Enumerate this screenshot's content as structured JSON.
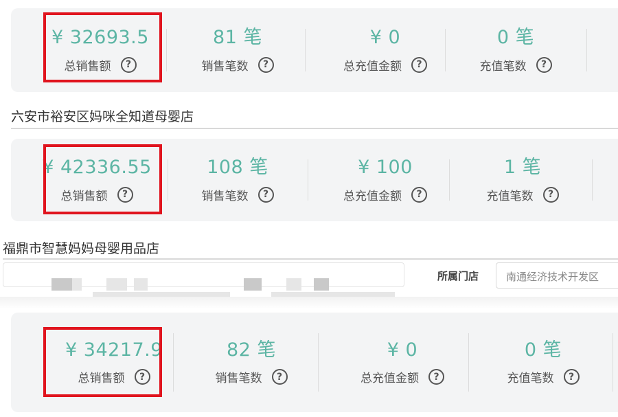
{
  "stores": [
    {
      "name": "",
      "stats": [
        {
          "value": "¥ 32693.5",
          "label": "总销售额"
        },
        {
          "value": "81 笔",
          "label": "销售笔数"
        },
        {
          "value": "¥ 0",
          "label": "总充值金额"
        },
        {
          "value": "0 笔",
          "label": "充值笔数"
        }
      ]
    },
    {
      "name": "六安市裕安区妈咪全知道母婴店",
      "stats": [
        {
          "value": "¥ 42336.55",
          "label": "总销售额"
        },
        {
          "value": "108 笔",
          "label": "销售笔数"
        },
        {
          "value": "¥ 100",
          "label": "总充值金额"
        },
        {
          "value": "1 笔",
          "label": "充值笔数"
        }
      ]
    },
    {
      "name": "福鼎市智慧妈妈母婴用品店",
      "stats": [
        {
          "value": "¥ 34217.9",
          "label": "总销售额"
        },
        {
          "value": "82 笔",
          "label": "销售笔数"
        },
        {
          "value": "¥ 0",
          "label": "总充值金额"
        },
        {
          "value": "0 笔",
          "label": "充值笔数"
        }
      ]
    }
  ],
  "help_icon_glyph": "?",
  "filter": {
    "store_label": "所属门店",
    "store_value": "南通经济技术开发区"
  },
  "colors": {
    "value_teal": "#5cb5a4",
    "highlight_red": "#e0141e",
    "panel_bg": "#f3f4f5"
  },
  "icons": [
    "question-circle-icon"
  ]
}
